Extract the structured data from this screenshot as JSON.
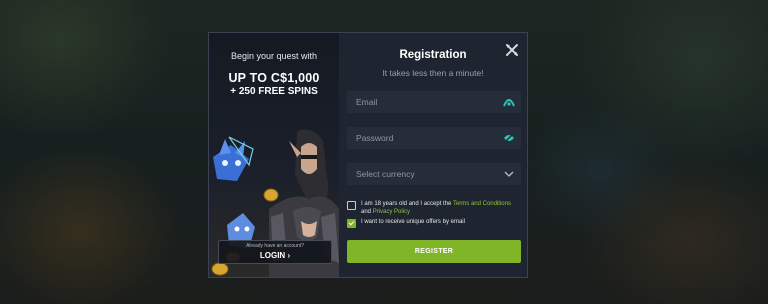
{
  "promo": {
    "line1": "Begin your quest with",
    "line2": "UP TO C$1,000",
    "line3": "+ 250 FREE SPINS",
    "login_hint": "Already have an account?",
    "login_label": "LOGIN",
    "login_arrow": "›"
  },
  "form": {
    "title": "Registration",
    "subtitle": "It takes less then a minute!",
    "email_placeholder": "Email",
    "password_placeholder": "Password",
    "currency_placeholder": "Select currency",
    "terms_prefix": "I am 18 years old and I accept the",
    "terms_link": "Terms and Conditions",
    "terms_and": "and",
    "privacy_link": "Privacy Policy",
    "offers_label": "I want to receive unique offers by email",
    "terms_checked": false,
    "offers_checked": true,
    "register_label": "REGISTER"
  },
  "icons": {
    "close": "close-icon",
    "email": "email-icon",
    "password": "password-icon",
    "currency": "chevron-down-icon"
  },
  "colors": {
    "accent": "#7fb526",
    "link": "#8fc43a",
    "modal_bg": "#1e2430",
    "field_bg": "#262d3a",
    "icon_teal": "#2ec4b6"
  }
}
